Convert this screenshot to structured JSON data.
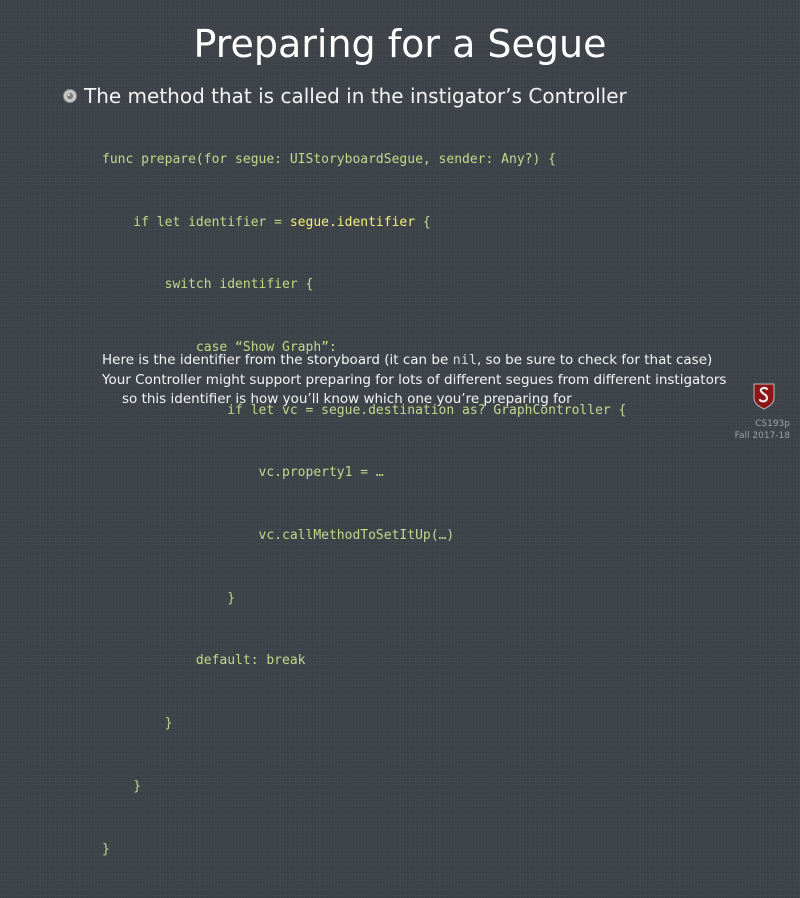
{
  "title": "Preparing for a Segue",
  "bullet": "The method that is called in the instigator’s Controller",
  "code": {
    "line1": "func prepare(for segue: UIStoryboardSegue, sender: Any?) {",
    "line2_pre": "    if let identifier = ",
    "line2_hl": "segue.identifier",
    "line2_post": " {",
    "line3": "        switch identifier {",
    "line4": "            case “Show Graph”:",
    "line5": "                if let vc = segue.destination as? GraphController {",
    "line6": "                    vc.property1 = …",
    "line7": "                    vc.callMethodToSetItUp(…)",
    "line8": "                }",
    "line9": "            default: break",
    "line10": "        }",
    "line11": "    }",
    "line12": "}"
  },
  "notes": {
    "line1_pre": "Here is the identifier from the storyboard (it can be ",
    "line1_nil": "nil",
    "line1_post": ", so be sure to check for that case)",
    "line2": "Your Controller might support preparing for lots of different segues from different instigators",
    "line3": "so this identifier is how you’ll know which one you’re preparing for"
  },
  "footer": {
    "course": "CS193p",
    "term": "Fall  2017-18"
  },
  "colors": {
    "background": "#3d4249",
    "code": "#c4d88a",
    "highlight": "#f5ef7a"
  }
}
